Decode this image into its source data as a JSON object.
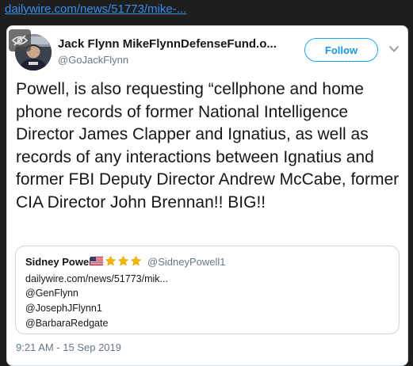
{
  "page": {
    "url_text": "dailywire.com/news/51773/mike-..."
  },
  "tweet": {
    "author_name": "Jack Flynn MikeFlynnDefenseFund.o...",
    "author_handle": "@GoJackFlynn",
    "follow_label": "Follow",
    "text": "Powell, is also requesting “cellphone and home phone records of former National Intelligence Director James Clapper and Ignatius, as well as records of any interactions between Ignatius and former FBI Deputy Director Andrew McCabe, former CIA Director John Brennan!! BIG!!",
    "timestamp": "9:21 AM - 15 Sep 2019",
    "icons": {
      "hide": "eye-slash-icon",
      "menu": "chevron-down-icon"
    }
  },
  "quote": {
    "author_name": "Sidney Powell",
    "author_handle": "@SidneyPowell1",
    "flag": "us-flag-icon",
    "star_count": 3,
    "lines": [
      "dailywire.com/news/51773/mik...",
      "@GenFlynn",
      "@JosephJFlynn1",
      "@BarbaraRedgate"
    ]
  },
  "colors": {
    "page_background": "#1e1e1e",
    "link": "#3b8beb",
    "follow_accent": "#1da1f2",
    "text_primary": "#14171a",
    "text_secondary": "#657786",
    "star": "#f4b400"
  }
}
